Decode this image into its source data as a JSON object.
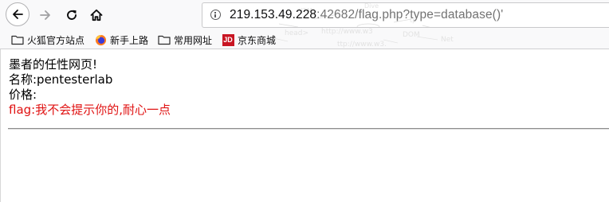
{
  "toolbar": {
    "icons": {
      "back": "back-arrow-icon",
      "forward": "forward-arrow-icon",
      "reload": "reload-icon",
      "home": "home-icon",
      "site_info": "info-icon"
    },
    "url": {
      "host": "219.153.49.228",
      "rest": ":42682/flag.php?type=database()'"
    }
  },
  "bookmarks": [
    {
      "label": "火狐官方站点",
      "icon": "folder-icon"
    },
    {
      "label": "新手上路",
      "icon": "firefox-icon"
    },
    {
      "label": "常用网址",
      "icon": "folder-icon"
    },
    {
      "label": "京东商城",
      "icon": "jd-icon",
      "icon_text": "JD"
    }
  ],
  "page": {
    "heading": "墨者的任性网页!",
    "name_line": "名称:pentesterlab",
    "price_line": "价格:",
    "flag_line": "flag:我不会提示你的,耐心一点"
  },
  "colors": {
    "flag_text": "#e01212",
    "toolbar_bg": "#f9f9fa",
    "jd_brand": "#c81623"
  }
}
